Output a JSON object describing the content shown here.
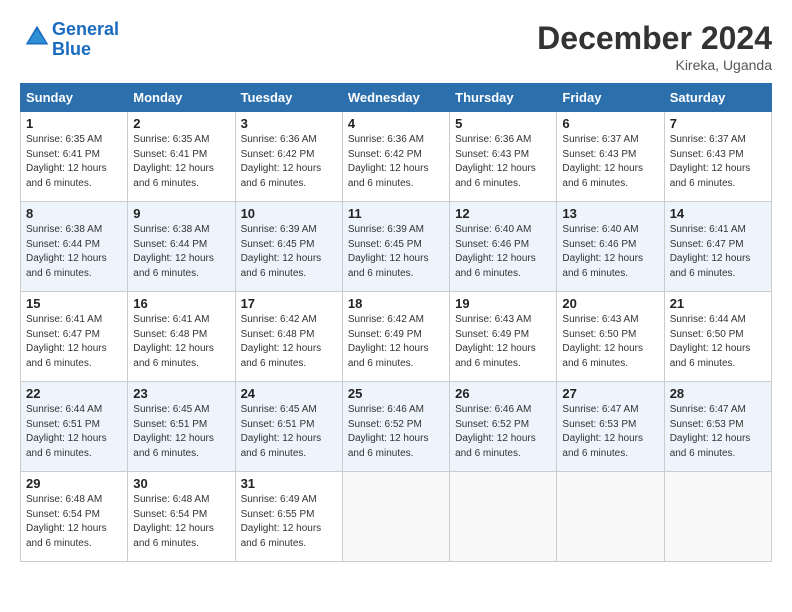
{
  "header": {
    "logo_line1": "General",
    "logo_line2": "Blue",
    "month": "December 2024",
    "location": "Kireka, Uganda"
  },
  "days_of_week": [
    "Sunday",
    "Monday",
    "Tuesday",
    "Wednesday",
    "Thursday",
    "Friday",
    "Saturday"
  ],
  "weeks": [
    [
      {
        "num": "1",
        "sunrise": "6:35 AM",
        "sunset": "6:41 PM",
        "daylight": "12 hours and 6 minutes."
      },
      {
        "num": "2",
        "sunrise": "6:35 AM",
        "sunset": "6:41 PM",
        "daylight": "12 hours and 6 minutes."
      },
      {
        "num": "3",
        "sunrise": "6:36 AM",
        "sunset": "6:42 PM",
        "daylight": "12 hours and 6 minutes."
      },
      {
        "num": "4",
        "sunrise": "6:36 AM",
        "sunset": "6:42 PM",
        "daylight": "12 hours and 6 minutes."
      },
      {
        "num": "5",
        "sunrise": "6:36 AM",
        "sunset": "6:43 PM",
        "daylight": "12 hours and 6 minutes."
      },
      {
        "num": "6",
        "sunrise": "6:37 AM",
        "sunset": "6:43 PM",
        "daylight": "12 hours and 6 minutes."
      },
      {
        "num": "7",
        "sunrise": "6:37 AM",
        "sunset": "6:43 PM",
        "daylight": "12 hours and 6 minutes."
      }
    ],
    [
      {
        "num": "8",
        "sunrise": "6:38 AM",
        "sunset": "6:44 PM",
        "daylight": "12 hours and 6 minutes."
      },
      {
        "num": "9",
        "sunrise": "6:38 AM",
        "sunset": "6:44 PM",
        "daylight": "12 hours and 6 minutes."
      },
      {
        "num": "10",
        "sunrise": "6:39 AM",
        "sunset": "6:45 PM",
        "daylight": "12 hours and 6 minutes."
      },
      {
        "num": "11",
        "sunrise": "6:39 AM",
        "sunset": "6:45 PM",
        "daylight": "12 hours and 6 minutes."
      },
      {
        "num": "12",
        "sunrise": "6:40 AM",
        "sunset": "6:46 PM",
        "daylight": "12 hours and 6 minutes."
      },
      {
        "num": "13",
        "sunrise": "6:40 AM",
        "sunset": "6:46 PM",
        "daylight": "12 hours and 6 minutes."
      },
      {
        "num": "14",
        "sunrise": "6:41 AM",
        "sunset": "6:47 PM",
        "daylight": "12 hours and 6 minutes."
      }
    ],
    [
      {
        "num": "15",
        "sunrise": "6:41 AM",
        "sunset": "6:47 PM",
        "daylight": "12 hours and 6 minutes."
      },
      {
        "num": "16",
        "sunrise": "6:41 AM",
        "sunset": "6:48 PM",
        "daylight": "12 hours and 6 minutes."
      },
      {
        "num": "17",
        "sunrise": "6:42 AM",
        "sunset": "6:48 PM",
        "daylight": "12 hours and 6 minutes."
      },
      {
        "num": "18",
        "sunrise": "6:42 AM",
        "sunset": "6:49 PM",
        "daylight": "12 hours and 6 minutes."
      },
      {
        "num": "19",
        "sunrise": "6:43 AM",
        "sunset": "6:49 PM",
        "daylight": "12 hours and 6 minutes."
      },
      {
        "num": "20",
        "sunrise": "6:43 AM",
        "sunset": "6:50 PM",
        "daylight": "12 hours and 6 minutes."
      },
      {
        "num": "21",
        "sunrise": "6:44 AM",
        "sunset": "6:50 PM",
        "daylight": "12 hours and 6 minutes."
      }
    ],
    [
      {
        "num": "22",
        "sunrise": "6:44 AM",
        "sunset": "6:51 PM",
        "daylight": "12 hours and 6 minutes."
      },
      {
        "num": "23",
        "sunrise": "6:45 AM",
        "sunset": "6:51 PM",
        "daylight": "12 hours and 6 minutes."
      },
      {
        "num": "24",
        "sunrise": "6:45 AM",
        "sunset": "6:51 PM",
        "daylight": "12 hours and 6 minutes."
      },
      {
        "num": "25",
        "sunrise": "6:46 AM",
        "sunset": "6:52 PM",
        "daylight": "12 hours and 6 minutes."
      },
      {
        "num": "26",
        "sunrise": "6:46 AM",
        "sunset": "6:52 PM",
        "daylight": "12 hours and 6 minutes."
      },
      {
        "num": "27",
        "sunrise": "6:47 AM",
        "sunset": "6:53 PM",
        "daylight": "12 hours and 6 minutes."
      },
      {
        "num": "28",
        "sunrise": "6:47 AM",
        "sunset": "6:53 PM",
        "daylight": "12 hours and 6 minutes."
      }
    ],
    [
      {
        "num": "29",
        "sunrise": "6:48 AM",
        "sunset": "6:54 PM",
        "daylight": "12 hours and 6 minutes."
      },
      {
        "num": "30",
        "sunrise": "6:48 AM",
        "sunset": "6:54 PM",
        "daylight": "12 hours and 6 minutes."
      },
      {
        "num": "31",
        "sunrise": "6:49 AM",
        "sunset": "6:55 PM",
        "daylight": "12 hours and 6 minutes."
      },
      null,
      null,
      null,
      null
    ]
  ]
}
